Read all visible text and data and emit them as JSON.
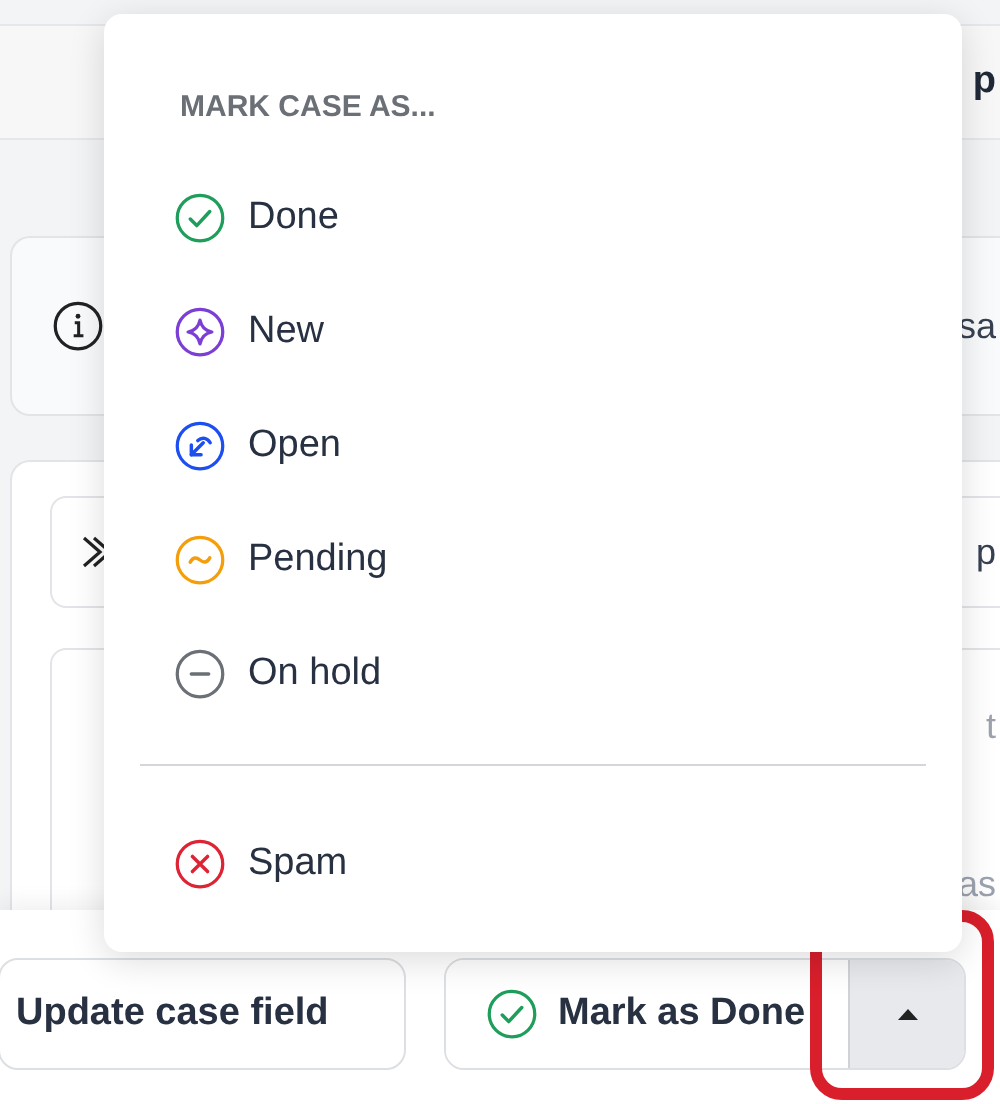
{
  "header": {
    "text": "p"
  },
  "info_card": {
    "text": "sa"
  },
  "content": {
    "chip_text": "p",
    "field": {
      "side_text": "t"
    },
    "footer_text": "as"
  },
  "menu": {
    "title": "MARK CASE AS...",
    "sections": [
      {
        "items": [
          {
            "label": "Done",
            "kind": "done",
            "color": "#1e9e5a"
          },
          {
            "label": "New",
            "kind": "new",
            "color": "#7b3fd6"
          },
          {
            "label": "Open",
            "kind": "open",
            "color": "#1d4ef0"
          },
          {
            "label": "Pending",
            "kind": "pending",
            "color": "#f59e0b"
          },
          {
            "label": "On hold",
            "kind": "hold",
            "color": "#6b6f76"
          }
        ]
      },
      {
        "items": [
          {
            "label": "Spam",
            "kind": "spam",
            "color": "#dc2434"
          }
        ]
      }
    ]
  },
  "actions": {
    "secondary": "Update case field",
    "primary": "Mark as Done",
    "toggle": {
      "highlighted": true
    }
  }
}
